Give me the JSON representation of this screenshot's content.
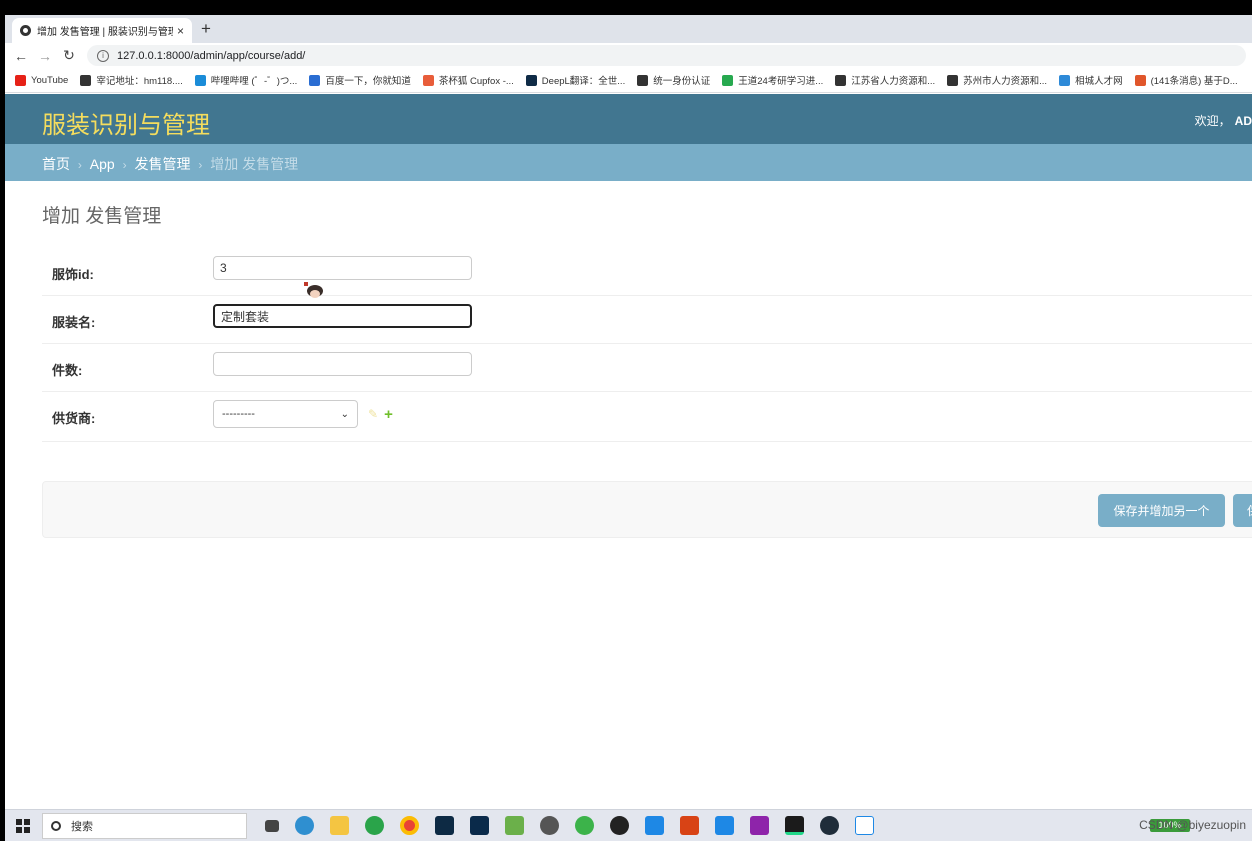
{
  "browser": {
    "tab_title": "增加 发售管理 | 服装识别与管理...",
    "tab_close": "×",
    "new_tab": "+",
    "back": "←",
    "forward": "→",
    "reload": "↻",
    "url": "127.0.0.1:8000/admin/app/course/add/",
    "bookmarks": [
      {
        "label": "YouTube",
        "color": "#e62117"
      },
      {
        "label": "宰记地址：hm118....",
        "color": "#333333"
      },
      {
        "label": "哔哩哔哩 (゜-゜)つ...",
        "color": "#1a8cd8"
      },
      {
        "label": "百度一下，你就知道",
        "color": "#2a6dd2"
      },
      {
        "label": "茶杯狐 Cupfox -...",
        "color": "#e85d3a"
      },
      {
        "label": "DeepL翻译：全世...",
        "color": "#0f2b46"
      },
      {
        "label": "统一身份认证",
        "color": "#333333"
      },
      {
        "label": "王道24考研学习进...",
        "color": "#27a94f"
      },
      {
        "label": "江苏省人力资源和...",
        "color": "#333333"
      },
      {
        "label": "苏州市人力资源和...",
        "color": "#333333"
      },
      {
        "label": "相城人才网",
        "color": "#2e8ad8"
      },
      {
        "label": "(141条消息) 基于D...",
        "color": "#e0562b"
      }
    ]
  },
  "admin": {
    "brand": "服装识别与管理",
    "welcome": "欢迎，",
    "user": "AD",
    "breadcrumbs": {
      "home": "首页",
      "app": "App",
      "model": "发售管理",
      "current": "增加 发售管理",
      "sep": "›"
    },
    "page_title": "增加 发售管理",
    "fields": [
      {
        "label": "服饰id:",
        "value": "3"
      },
      {
        "label": "服装名:",
        "value": "定制套装"
      },
      {
        "label": "件数:",
        "value": ""
      },
      {
        "label": "供货商:",
        "value": "---------"
      }
    ],
    "edit_icon": "✎",
    "add_icon": "+",
    "buttons": {
      "save_add_another": "保存并增加另一个",
      "save": "保"
    }
  },
  "taskbar": {
    "search_label": "搜索",
    "battery": "100%",
    "watermark": "CSDN @biyezuopin"
  }
}
